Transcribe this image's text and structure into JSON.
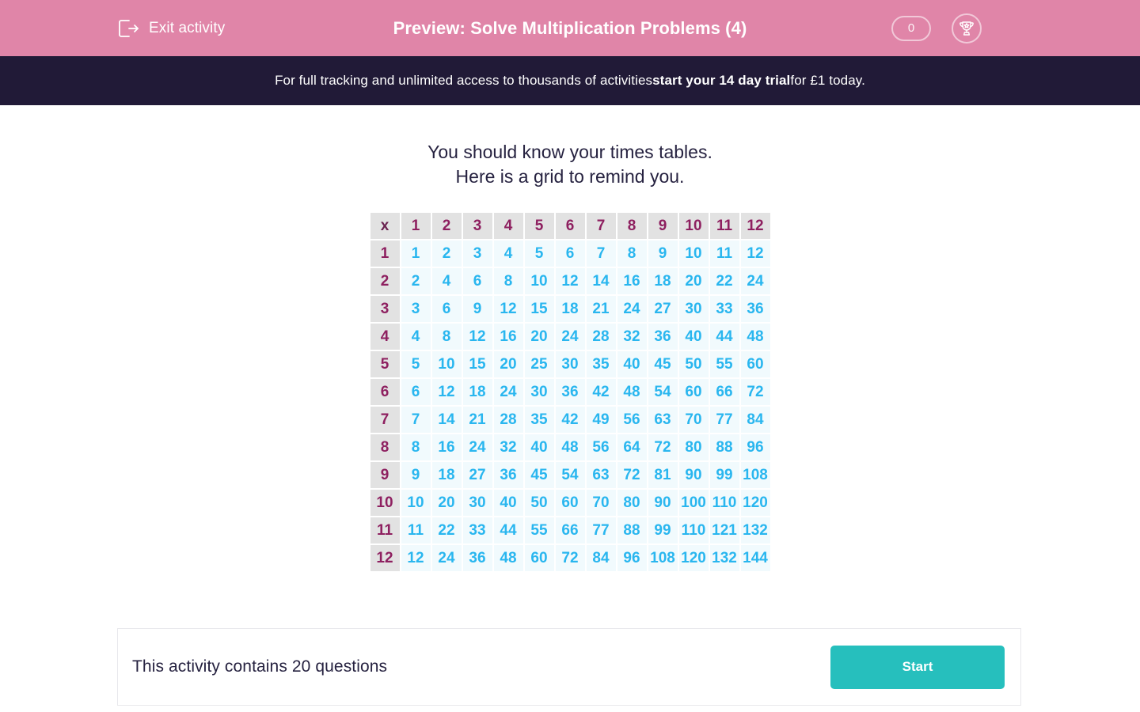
{
  "header": {
    "exit_label": "Exit activity",
    "exit_icon": "exit-arrow-icon",
    "title": "Preview: Solve Multiplication Problems (4)",
    "score": "0",
    "trophy_icon": "trophy-icon",
    "background_color": "#e085a8"
  },
  "banner": {
    "text_before": "For full tracking and unlimited access to thousands of activities ",
    "text_bold": "start your 14 day trial",
    "text_after": " for £1 today.",
    "background_color": "#211a37"
  },
  "main": {
    "prompt_line1": "You should know your times tables.",
    "prompt_line2": "Here is a grid to remind you."
  },
  "chart_data": {
    "type": "table",
    "title": "Multiplication grid 1-12",
    "corner_label": "x",
    "categories": [
      1,
      2,
      3,
      4,
      5,
      6,
      7,
      8,
      9,
      10,
      11,
      12
    ],
    "col_headers": [
      "1",
      "2",
      "3",
      "4",
      "5",
      "6",
      "7",
      "8",
      "9",
      "10",
      "11",
      "12"
    ],
    "row_headers": [
      "1",
      "2",
      "3",
      "4",
      "5",
      "6",
      "7",
      "8",
      "9",
      "10",
      "11",
      "12"
    ],
    "header_text_color": "#8e2060",
    "header_cell_color": "#e2e2e2",
    "body_text_color": "#29b6ef",
    "body_cell_color": "#f1fafd",
    "rows": [
      [
        "1",
        "2",
        "3",
        "4",
        "5",
        "6",
        "7",
        "8",
        "9",
        "10",
        "11",
        "12"
      ],
      [
        "2",
        "4",
        "6",
        "8",
        "10",
        "12",
        "14",
        "16",
        "18",
        "20",
        "22",
        "24"
      ],
      [
        "3",
        "6",
        "9",
        "12",
        "15",
        "18",
        "21",
        "24",
        "27",
        "30",
        "33",
        "36"
      ],
      [
        "4",
        "8",
        "12",
        "16",
        "20",
        "24",
        "28",
        "32",
        "36",
        "40",
        "44",
        "48"
      ],
      [
        "5",
        "10",
        "15",
        "20",
        "25",
        "30",
        "35",
        "40",
        "45",
        "50",
        "55",
        "60"
      ],
      [
        "6",
        "12",
        "18",
        "24",
        "30",
        "36",
        "42",
        "48",
        "54",
        "60",
        "66",
        "72"
      ],
      [
        "7",
        "14",
        "21",
        "28",
        "35",
        "42",
        "49",
        "56",
        "63",
        "70",
        "77",
        "84"
      ],
      [
        "8",
        "16",
        "24",
        "32",
        "40",
        "48",
        "56",
        "64",
        "72",
        "80",
        "88",
        "96"
      ],
      [
        "9",
        "18",
        "27",
        "36",
        "45",
        "54",
        "63",
        "72",
        "81",
        "90",
        "99",
        "108"
      ],
      [
        "10",
        "20",
        "30",
        "40",
        "50",
        "60",
        "70",
        "80",
        "90",
        "100",
        "110",
        "120"
      ],
      [
        "11",
        "22",
        "33",
        "44",
        "55",
        "66",
        "77",
        "88",
        "99",
        "110",
        "121",
        "132"
      ],
      [
        "12",
        "24",
        "36",
        "48",
        "60",
        "72",
        "84",
        "96",
        "108",
        "120",
        "132",
        "144"
      ]
    ]
  },
  "footer": {
    "question_count_text": "This activity contains 20 questions",
    "start_label": "Start",
    "start_color": "#26bfbd"
  }
}
